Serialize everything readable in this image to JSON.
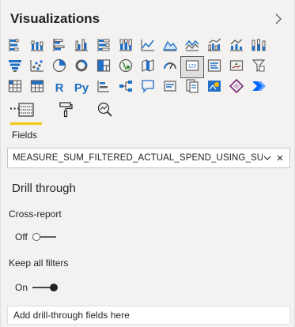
{
  "pane": {
    "title": "Visualizations",
    "collapse_icon": "chevron-right-icon"
  },
  "visuals": [
    "stacked-bar-chart-icon",
    "stacked-column-chart-icon",
    "clustered-bar-chart-icon",
    "clustered-column-chart-icon",
    "100-stacked-bar-chart-icon",
    "100-stacked-column-chart-icon",
    "line-chart-icon",
    "area-chart-icon",
    "stacked-area-chart-icon",
    "line-clustered-column-chart-icon",
    "line-stacked-column-chart-icon",
    "ribbon-chart-icon",
    "funnel-icon",
    "scatter-chart-icon",
    "pie-chart-icon",
    "donut-chart-icon",
    "treemap-icon",
    "map-icon",
    "filled-map-icon",
    "gauge-icon",
    "card-icon",
    "multi-row-card-icon",
    "kpi-icon",
    "slicer-icon",
    "table-icon",
    "r-visual-icon",
    "python-visual-icon",
    "key-influencers-icon",
    "decomposition-tree-icon",
    "qa-icon",
    "smart-narrative-icon",
    "paginated-report-icon",
    "arcgis-map-icon",
    "power-apps-icon",
    "power-automate-icon",
    "more-visuals-icon"
  ],
  "visual_text": {
    "r": "R",
    "py": "Py",
    "more": "···"
  },
  "tabs": [
    {
      "icon": "fields-tab-icon",
      "active": true
    },
    {
      "icon": "format-paint-roller-icon",
      "active": false
    },
    {
      "icon": "analytics-magnifier-icon",
      "active": false
    }
  ],
  "fields": {
    "label": "Fields",
    "value": "MEASURE_SUM_FILTERED_ACTUAL_SPEND_USING_SUM"
  },
  "drill_through": {
    "title": "Drill through",
    "cross_report_label": "Cross-report",
    "cross_report_state": "Off",
    "keep_filters_label": "Keep all filters",
    "keep_filters_state": "On",
    "add_fields_placeholder": "Add drill-through fields here"
  },
  "colors": {
    "accent_yellow": "#f2c811",
    "blue": "#1e6fc5",
    "background": "#f3f2f1"
  }
}
